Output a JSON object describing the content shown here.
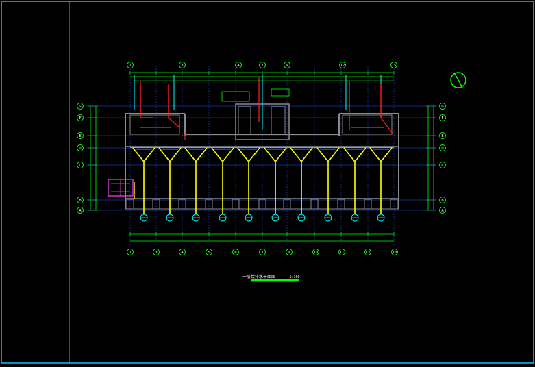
{
  "drawing": {
    "axes_top": [
      "1",
      "3",
      "4",
      "7",
      "9",
      "12",
      "15"
    ],
    "axes_bottom": [
      "1",
      "3",
      "4",
      "5",
      "6",
      "7",
      "9",
      "10",
      "11",
      "12",
      "13",
      "14",
      "15"
    ],
    "axes_left": [
      "G",
      "F",
      "E",
      "D",
      "C",
      "B",
      "A"
    ],
    "axes_right": [
      "G",
      "F",
      "E",
      "D",
      "C",
      "B",
      "A"
    ],
    "caption": "一层给排水平面图",
    "scale": "1:100"
  },
  "colors": {
    "background": "#000000",
    "frame": "#00c8ff",
    "dimension": "#00ff00",
    "axis_line": "#2255ff",
    "wall": "#8a8a8a",
    "cold_water": "#00ffff",
    "drain": "#ffff00",
    "hot_water": "#ff2020",
    "equipment": "#ff40ff",
    "text": "#ffffff"
  }
}
